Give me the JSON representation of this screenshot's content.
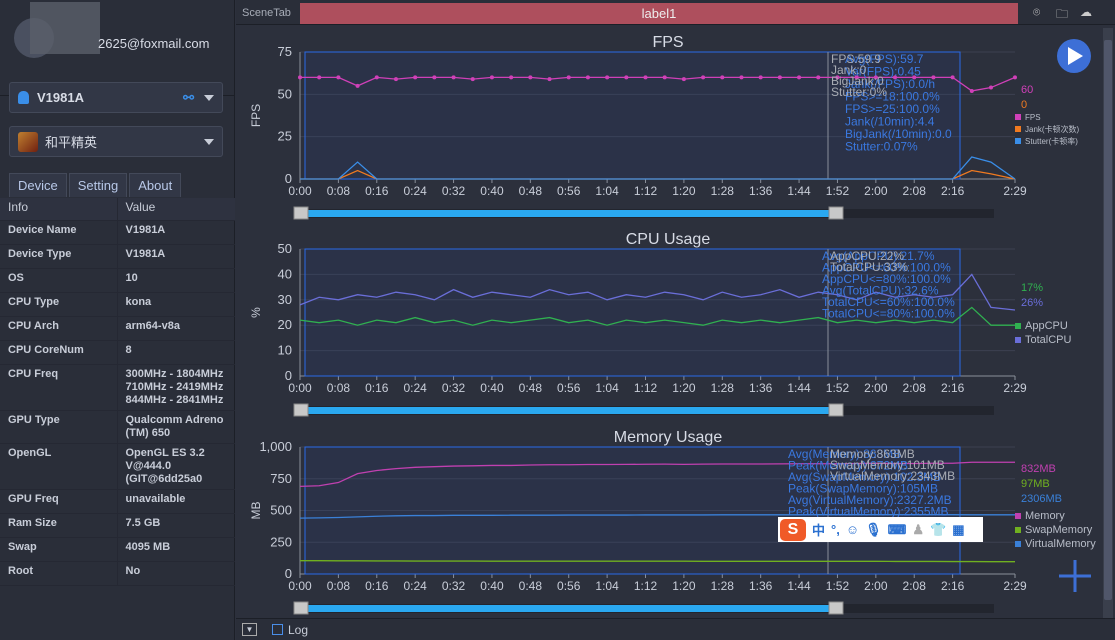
{
  "user": {
    "email": "2625@foxmail.com"
  },
  "device_select": {
    "value": "V1981A",
    "icon": "android-icon"
  },
  "app_select": {
    "value": "和平精英"
  },
  "tabs": [
    "Device",
    "Setting",
    "About"
  ],
  "info_table": {
    "headers": [
      "Info",
      "Value"
    ],
    "rows": [
      [
        "Device Name",
        "V1981A"
      ],
      [
        "Device Type",
        "V1981A"
      ],
      [
        "OS",
        "10"
      ],
      [
        "CPU Type",
        "kona"
      ],
      [
        "CPU Arch",
        "arm64-v8a"
      ],
      [
        "CPU CoreNum",
        "8"
      ],
      [
        "CPU Freq",
        "300MHz - 1804MHz\n710MHz - 2419MHz\n844MHz - 2841MHz"
      ],
      [
        "GPU Type",
        "Qualcomm Adreno (TM) 650"
      ],
      [
        "OpenGL",
        "OpenGL ES 3.2 V@444.0 (GIT@6dd25a0"
      ],
      [
        "GPU Freq",
        "unavailable"
      ],
      [
        "Ram Size",
        "7.5 GB"
      ],
      [
        "Swap",
        "4095 MB"
      ],
      [
        "Root",
        "No"
      ]
    ]
  },
  "topbar": {
    "scene_tab": "SceneTab",
    "label": "label1",
    "label_color": "#ae4f5d",
    "icons": [
      "location-icon",
      "folder-icon",
      "cloud-icon"
    ]
  },
  "bottom": {
    "log_label": "Log"
  },
  "ime": {
    "chars": [
      "中",
      "°,"
    ]
  },
  "chart_data": [
    {
      "type": "line",
      "title": "FPS",
      "ylabel": "FPS",
      "ylim": [
        0,
        75
      ],
      "yticks": [
        0,
        25,
        50,
        75
      ],
      "xticks": [
        "0:00",
        "0:08",
        "0:16",
        "0:24",
        "0:32",
        "0:40",
        "0:48",
        "0:56",
        "1:04",
        "1:12",
        "1:20",
        "1:28",
        "1:36",
        "1:44",
        "1:52",
        "2:00",
        "2:08",
        "2:16",
        "2:29"
      ],
      "x": [
        "0:00",
        "0:04",
        "0:08",
        "0:12",
        "0:16",
        "0:20",
        "0:24",
        "0:28",
        "0:32",
        "0:36",
        "0:40",
        "0:44",
        "0:48",
        "0:52",
        "0:56",
        "1:00",
        "1:04",
        "1:08",
        "1:12",
        "1:16",
        "1:20",
        "1:24",
        "1:28",
        "1:32",
        "1:36",
        "1:40",
        "1:44",
        "1:48",
        "1:52",
        "1:56",
        "2:00",
        "2:04",
        "2:08",
        "2:12",
        "2:16",
        "2:20",
        "2:24",
        "2:29"
      ],
      "series": [
        {
          "name": "FPS",
          "color": "#d040b8",
          "values": [
            60,
            60,
            60,
            55,
            60,
            59,
            60,
            60,
            60,
            59,
            60,
            60,
            60,
            59,
            60,
            60,
            60,
            60,
            60,
            60,
            59,
            60,
            60,
            60,
            60,
            60,
            60,
            60,
            60,
            60,
            60,
            60,
            60,
            60,
            60,
            52,
            54,
            60
          ]
        },
        {
          "name": "Jank(卡顿次数)",
          "color": "#f07a20",
          "values": [
            0,
            0,
            0,
            5,
            0,
            0,
            0,
            0,
            0,
            0,
            0,
            0,
            0,
            0,
            0,
            0,
            0,
            0,
            0,
            0,
            0,
            0,
            0,
            0,
            0,
            0,
            0,
            0,
            0,
            0,
            0,
            0,
            0,
            0,
            0,
            5,
            3,
            0
          ]
        },
        {
          "name": "Stutter(卡顿率)",
          "color": "#3a8ee8",
          "values": [
            0,
            0,
            0,
            10,
            0,
            0,
            0,
            0,
            0,
            0,
            0,
            0,
            0,
            0,
            0,
            0,
            0,
            0,
            0,
            0,
            0,
            0,
            0,
            0,
            0,
            0,
            0,
            0,
            0,
            0,
            0,
            0,
            0,
            0,
            0,
            13,
            10,
            0
          ]
        }
      ],
      "current_values": [
        "60",
        "0"
      ],
      "stats": [
        "Avg(FPS):59.7",
        "Var(FPS):0.45",
        "Jank(/FPS):0.0/h",
        "FPS>=18:100.0%",
        "FPS>=25:100.0%",
        "Jank(/10min):4.4",
        "BigJank(/10min):0.0",
        "Stutter:0.07%"
      ],
      "cursor": [
        "FPS:59.9",
        "Jank:0",
        "BigJank:0",
        "Stutter:0%"
      ]
    },
    {
      "type": "line",
      "title": "CPU Usage",
      "ylabel": "%",
      "ylim": [
        0,
        50
      ],
      "yticks": [
        0,
        10,
        20,
        30,
        40,
        50
      ],
      "series": [
        {
          "name": "AppCPU",
          "color": "#30b050",
          "values": [
            22,
            21,
            22,
            20,
            22,
            21,
            23,
            21,
            22,
            20,
            22,
            21,
            22,
            23,
            21,
            22,
            20,
            22,
            21,
            22,
            21,
            20,
            22,
            21,
            22,
            21,
            22,
            23,
            21,
            22,
            21,
            22,
            21,
            22,
            21,
            27,
            20,
            20
          ]
        },
        {
          "name": "TotalCPU",
          "color": "#6a6ed8",
          "values": [
            28,
            31,
            30,
            32,
            31,
            33,
            32,
            30,
            34,
            31,
            33,
            32,
            31,
            34,
            32,
            33,
            30,
            32,
            31,
            33,
            32,
            30,
            33,
            31,
            32,
            34,
            31,
            33,
            32,
            30,
            33,
            31,
            32,
            31,
            32,
            40,
            27,
            26
          ]
        }
      ],
      "current_values": [
        "17%",
        "26%"
      ],
      "stats": [
        "Avg(AppCPU):21.7%",
        "AppCPU<=60%:100.0%",
        "AppCPU<=80%:100.0%",
        "Avg(TotalCPU):32.6%",
        "TotalCPU<=60%:100.0%",
        "TotalCPU<=80%:100.0%"
      ],
      "cursor": [
        "AppCPU:22%",
        "TotalCPU:33%"
      ]
    },
    {
      "type": "line",
      "title": "Memory Usage",
      "ylabel": "MB",
      "ylim": [
        0,
        1000
      ],
      "yticks": [
        0,
        250,
        500,
        750,
        "1,000"
      ],
      "series": [
        {
          "name": "Memory",
          "color": "#c040b0",
          "values": [
            690,
            695,
            720,
            790,
            815,
            830,
            840,
            845,
            850,
            852,
            855,
            855,
            858,
            860,
            860,
            862,
            862,
            863,
            864,
            865,
            863,
            865,
            866,
            866,
            866,
            867,
            868,
            868,
            868,
            870,
            872,
            870,
            870,
            872,
            872,
            880,
            880,
            880
          ]
        },
        {
          "name": "SwapMemory",
          "color": "#70b020",
          "values": [
            105,
            105,
            104,
            104,
            103,
            103,
            102,
            102,
            102,
            102,
            101,
            101,
            101,
            101,
            101,
            101,
            101,
            101,
            101,
            101,
            101,
            100,
            100,
            100,
            100,
            100,
            100,
            100,
            100,
            100,
            100,
            99,
            99,
            99,
            98,
            98,
            97,
            97
          ]
        },
        {
          "name": "VirtualMemory",
          "color": "#3a80d8",
          "values": [
            440,
            442,
            445,
            450,
            455,
            458,
            460,
            460,
            462,
            462,
            462,
            463,
            463,
            463,
            464,
            464,
            464,
            464,
            465,
            465,
            465,
            465,
            466,
            466,
            466,
            466,
            466,
            467,
            467,
            467,
            467,
            467,
            467,
            467,
            467,
            466,
            466,
            466
          ]
        }
      ],
      "current_values": [
        "832MB",
        "97MB",
        "2306MB"
      ],
      "stats": [
        "Avg(Memory):863MB",
        "Peak(Memory):872MB",
        "Avg(SwapMemory):102.3MB",
        "Peak(SwapMemory):105MB",
        "Avg(VirtualMemory):2327.2MB",
        "Peak(VirtualMemory):2355MB"
      ],
      "cursor": [
        "Memory:863MB",
        "SwapMemory:101MB",
        "VirtualMemory:2343MB"
      ]
    }
  ]
}
